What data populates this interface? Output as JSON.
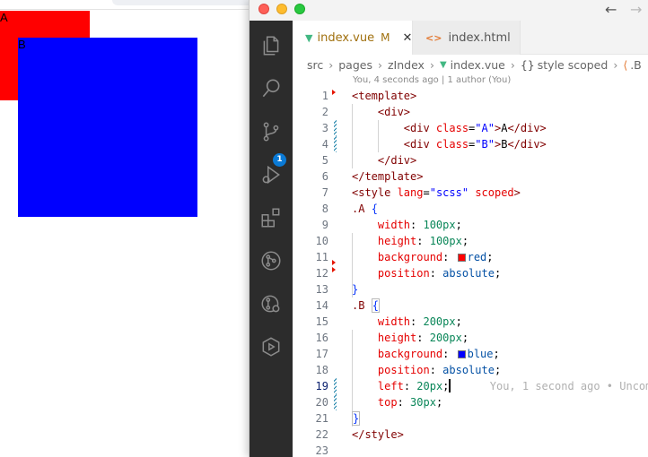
{
  "preview": {
    "box_a_label": "A",
    "box_b_label": "B",
    "box_a_color": "#ff0000",
    "box_b_color": "#0000ff"
  },
  "window": {
    "nav_back": "←",
    "nav_forward": "→"
  },
  "activity_bar": {
    "items": [
      "files-icon",
      "search-icon",
      "source-control-icon",
      "run-debug-icon",
      "extensions-icon",
      "git-graph-icon",
      "gitlens-icon",
      "remote-icon"
    ],
    "source_control_badge": "1"
  },
  "tabs": [
    {
      "label": "index.vue",
      "status": "M",
      "active": true,
      "icon": "vue-icon"
    },
    {
      "label": "index.html",
      "active": false,
      "icon": "html-icon"
    }
  ],
  "breadcrumb": {
    "parts": [
      "src",
      "pages",
      "zIndex",
      "index.vue",
      "style scoped",
      ".B"
    ]
  },
  "blame_header": "You, 4 seconds ago | 1 author (You)",
  "editor": {
    "current_line": "19",
    "inline_blame": "You, 1 second ago • Uncom",
    "lines": [
      {
        "n": "1",
        "tokens": [
          {
            "c": "tk-tag",
            "t": "<template>"
          }
        ]
      },
      {
        "n": "2",
        "tokens": [
          {
            "c": "tk-punct",
            "t": "    "
          },
          {
            "c": "tk-tag",
            "t": "<div>"
          }
        ]
      },
      {
        "n": "3",
        "tokens": [
          {
            "c": "tk-punct",
            "t": "        "
          },
          {
            "c": "tk-tag",
            "t": "<div "
          },
          {
            "c": "tk-attr",
            "t": "class"
          },
          {
            "c": "tk-punct",
            "t": "="
          },
          {
            "c": "tk-str",
            "t": "\"A\""
          },
          {
            "c": "tk-tag",
            "t": ">"
          },
          {
            "c": "tk-punct",
            "t": "A"
          },
          {
            "c": "tk-tag",
            "t": "</div>"
          }
        ]
      },
      {
        "n": "4",
        "tokens": [
          {
            "c": "tk-punct",
            "t": "        "
          },
          {
            "c": "tk-tag",
            "t": "<div "
          },
          {
            "c": "tk-attr",
            "t": "class"
          },
          {
            "c": "tk-punct",
            "t": "="
          },
          {
            "c": "tk-str",
            "t": "\"B\""
          },
          {
            "c": "tk-tag",
            "t": ">"
          },
          {
            "c": "tk-punct",
            "t": "B"
          },
          {
            "c": "tk-tag",
            "t": "</div>"
          }
        ]
      },
      {
        "n": "5",
        "tokens": [
          {
            "c": "tk-punct",
            "t": "    "
          },
          {
            "c": "tk-tag",
            "t": "</div>"
          }
        ]
      },
      {
        "n": "6",
        "tokens": [
          {
            "c": "tk-tag",
            "t": "</template>"
          }
        ]
      },
      {
        "n": "7",
        "tokens": [
          {
            "c": "tk-tag",
            "t": "<style "
          },
          {
            "c": "tk-attr",
            "t": "lang"
          },
          {
            "c": "tk-punct",
            "t": "="
          },
          {
            "c": "tk-str",
            "t": "\"scss\""
          },
          {
            "c": "tk-punct",
            "t": " "
          },
          {
            "c": "tk-attr",
            "t": "scoped"
          },
          {
            "c": "tk-tag",
            "t": ">"
          }
        ]
      },
      {
        "n": "8",
        "tokens": [
          {
            "c": "tk-sel",
            "t": ".A"
          },
          {
            "c": "tk-punct",
            "t": " "
          },
          {
            "c": "tk-brace",
            "t": "{"
          }
        ]
      },
      {
        "n": "9",
        "tokens": [
          {
            "c": "tk-punct",
            "t": "    "
          },
          {
            "c": "tk-prop",
            "t": "width"
          },
          {
            "c": "tk-punct",
            "t": ": "
          },
          {
            "c": "tk-num",
            "t": "100px"
          },
          {
            "c": "tk-punct",
            "t": ";"
          }
        ]
      },
      {
        "n": "10",
        "tokens": [
          {
            "c": "tk-punct",
            "t": "    "
          },
          {
            "c": "tk-prop",
            "t": "height"
          },
          {
            "c": "tk-punct",
            "t": ": "
          },
          {
            "c": "tk-num",
            "t": "100px"
          },
          {
            "c": "tk-punct",
            "t": ";"
          }
        ]
      },
      {
        "n": "11",
        "tokens": [
          {
            "c": "tk-punct",
            "t": "    "
          },
          {
            "c": "tk-prop",
            "t": "background"
          },
          {
            "c": "tk-punct",
            "t": ": "
          },
          {
            "c": "swatch-red",
            "t": ""
          },
          {
            "c": "tk-val",
            "t": "red"
          },
          {
            "c": "tk-punct",
            "t": ";"
          }
        ]
      },
      {
        "n": "12",
        "tokens": [
          {
            "c": "tk-punct",
            "t": "    "
          },
          {
            "c": "tk-prop",
            "t": "position"
          },
          {
            "c": "tk-punct",
            "t": ": "
          },
          {
            "c": "tk-val",
            "t": "absolute"
          },
          {
            "c": "tk-punct",
            "t": ";"
          }
        ]
      },
      {
        "n": "13",
        "tokens": [
          {
            "c": "tk-brace",
            "t": "}"
          }
        ]
      },
      {
        "n": "14",
        "tokens": [
          {
            "c": "tk-sel",
            "t": ".B"
          },
          {
            "c": "tk-punct",
            "t": " "
          },
          {
            "c": "tk-brace-box",
            "t": "{"
          }
        ]
      },
      {
        "n": "15",
        "tokens": [
          {
            "c": "tk-punct",
            "t": "    "
          },
          {
            "c": "tk-prop",
            "t": "width"
          },
          {
            "c": "tk-punct",
            "t": ": "
          },
          {
            "c": "tk-num",
            "t": "200px"
          },
          {
            "c": "tk-punct",
            "t": ";"
          }
        ]
      },
      {
        "n": "16",
        "tokens": [
          {
            "c": "tk-punct",
            "t": "    "
          },
          {
            "c": "tk-prop",
            "t": "height"
          },
          {
            "c": "tk-punct",
            "t": ": "
          },
          {
            "c": "tk-num",
            "t": "200px"
          },
          {
            "c": "tk-punct",
            "t": ";"
          }
        ]
      },
      {
        "n": "17",
        "tokens": [
          {
            "c": "tk-punct",
            "t": "    "
          },
          {
            "c": "tk-prop",
            "t": "background"
          },
          {
            "c": "tk-punct",
            "t": ": "
          },
          {
            "c": "swatch-blue",
            "t": ""
          },
          {
            "c": "tk-val",
            "t": "blue"
          },
          {
            "c": "tk-punct",
            "t": ";"
          }
        ]
      },
      {
        "n": "18",
        "tokens": [
          {
            "c": "tk-punct",
            "t": "    "
          },
          {
            "c": "tk-prop",
            "t": "position"
          },
          {
            "c": "tk-punct",
            "t": ": "
          },
          {
            "c": "tk-val",
            "t": "absolute"
          },
          {
            "c": "tk-punct",
            "t": ";"
          }
        ]
      },
      {
        "n": "19",
        "tokens": [
          {
            "c": "tk-punct",
            "t": "    "
          },
          {
            "c": "tk-prop",
            "t": "left"
          },
          {
            "c": "tk-punct",
            "t": ": "
          },
          {
            "c": "tk-num",
            "t": "20px"
          },
          {
            "c": "tk-punct",
            "t": ";"
          },
          {
            "c": "cursor",
            "t": ""
          },
          {
            "c": "inline-blame",
            "t": "      You, 1 second ago • Uncom"
          }
        ]
      },
      {
        "n": "20",
        "tokens": [
          {
            "c": "tk-punct",
            "t": "    "
          },
          {
            "c": "tk-prop",
            "t": "top"
          },
          {
            "c": "tk-punct",
            "t": ": "
          },
          {
            "c": "tk-num",
            "t": "30px"
          },
          {
            "c": "tk-punct",
            "t": ";"
          }
        ]
      },
      {
        "n": "21",
        "tokens": [
          {
            "c": "tk-brace-box",
            "t": "}"
          }
        ]
      },
      {
        "n": "22",
        "tokens": [
          {
            "c": "tk-tag",
            "t": "</style>"
          }
        ]
      },
      {
        "n": "23",
        "tokens": []
      }
    ]
  }
}
